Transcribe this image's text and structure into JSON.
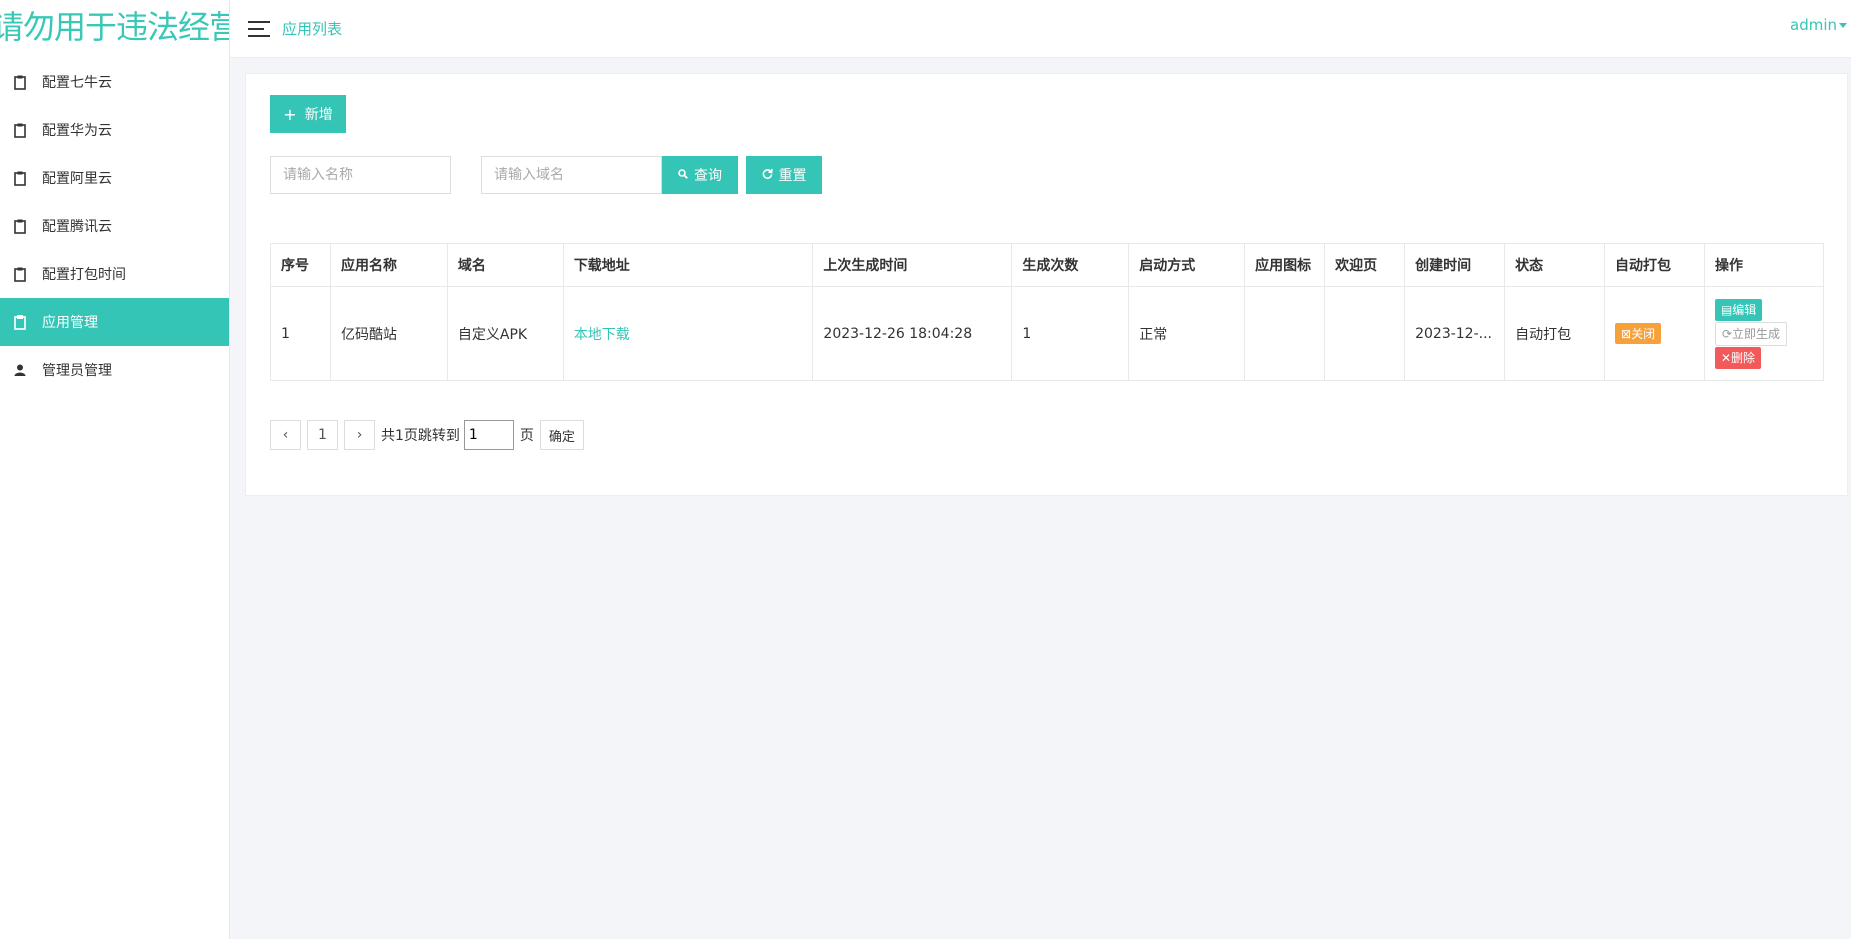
{
  "brand": {
    "logo_text": "请勿用于违法经营"
  },
  "header": {
    "title": "应用列表",
    "user": "admin"
  },
  "sidebar": {
    "items": [
      {
        "label": "配置七牛云",
        "icon": "clipboard-icon",
        "active": false
      },
      {
        "label": "配置华为云",
        "icon": "clipboard-icon",
        "active": false
      },
      {
        "label": "配置阿里云",
        "icon": "clipboard-icon",
        "active": false
      },
      {
        "label": "配置腾讯云",
        "icon": "clipboard-icon",
        "active": false
      },
      {
        "label": "配置打包时间",
        "icon": "clipboard-icon",
        "active": false
      },
      {
        "label": "应用管理",
        "icon": "clipboard-icon",
        "active": true
      },
      {
        "label": "管理员管理",
        "icon": "user-icon",
        "active": false
      }
    ]
  },
  "toolbar": {
    "add_label": "新增",
    "name_placeholder": "请输入名称",
    "domain_placeholder": "请输入域名",
    "search_label": "查询",
    "reset_label": "重置"
  },
  "table": {
    "headers": [
      "序号",
      "应用名称",
      "域名",
      "下载地址",
      "上次生成时间",
      "生成次数",
      "启动方式",
      "应用图标",
      "欢迎页",
      "创建时间",
      "状态",
      "自动打包",
      "操作"
    ],
    "rows": [
      {
        "index": "1",
        "name": "亿码酷站",
        "domain": "自定义APK",
        "download": "本地下载",
        "last_generated": "2023-12-26 18:04:28",
        "count": "1",
        "launch_mode": "正常",
        "icon": "",
        "welcome": "",
        "created": "2023-12-...",
        "status": "自动打包",
        "auto_pack": "关闭",
        "ops": {
          "edit": "编辑",
          "generate": "立即生成",
          "delete": "删除"
        }
      }
    ]
  },
  "pagination": {
    "prev": "‹",
    "current_page": "1",
    "next": "›",
    "summary": "共1页跳转到",
    "jump_value": "1",
    "page_unit": "页",
    "confirm": "确定"
  },
  "colors": {
    "accent": "#35c5b6",
    "warning": "#f7a13a",
    "danger": "#f05a5a"
  }
}
